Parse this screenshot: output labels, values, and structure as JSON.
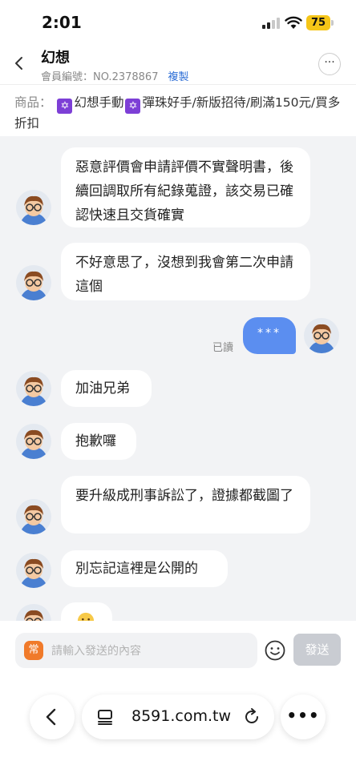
{
  "status_bar": {
    "time": "2:01",
    "battery": "75"
  },
  "header": {
    "title": "幻想",
    "member_label": "會員編號：NO.2378867",
    "copy_label": "複製",
    "more_label": "···"
  },
  "product": {
    "label": "商品：",
    "name_part1": "幻想手動",
    "name_part2": "彈珠好手/新版招待/刷滿150元/買多折扣",
    "star_glyph": "✡"
  },
  "messages": [
    {
      "side": "left",
      "text": "惡意評價會申請評價不實聲明書，後續回調取所有紀錄蒐證，該交易已確認快速且交貨確實"
    },
    {
      "side": "left",
      "text": "不好意思了，沒想到我會第二次申請這個"
    },
    {
      "side": "right",
      "text": "***",
      "read": "已讀"
    },
    {
      "side": "left",
      "text": "加油兄弟"
    },
    {
      "side": "left",
      "text": "抱歉囉"
    },
    {
      "side": "left",
      "text": "要升級成刑事訴訟了，證據都截圖了"
    },
    {
      "side": "left",
      "text": "別忘記這裡是公開的"
    }
  ],
  "input": {
    "quick_label": "常",
    "placeholder": "請輸入發送的內容",
    "send_label": "發送"
  },
  "browser": {
    "url": "8591.com.tw",
    "more_label": "•••"
  },
  "colors": {
    "accent": "#5b8ef0",
    "link": "#2f6fd6",
    "quick": "#f07a2a",
    "product_star": "#7d3fd6"
  }
}
